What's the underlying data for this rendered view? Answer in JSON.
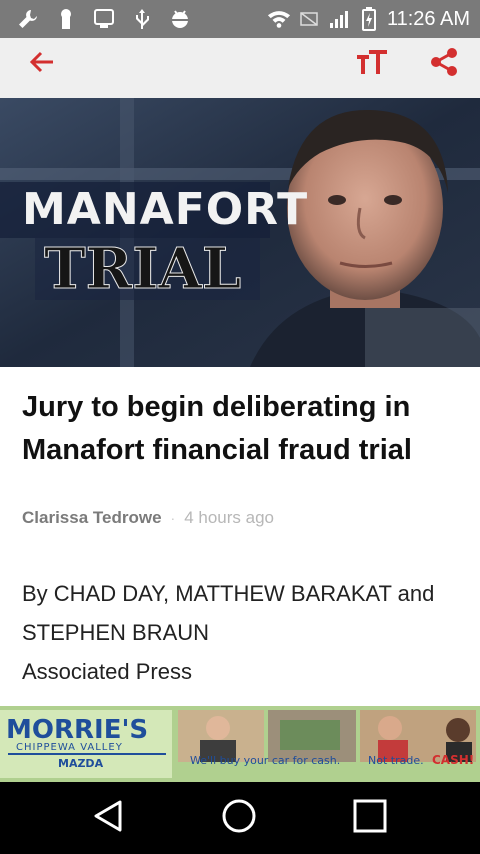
{
  "status_bar": {
    "time": "11:26 AM",
    "usb_badge": "100"
  },
  "toolbar": {
    "back_icon": "arrow-left-icon",
    "text_size_icon": "text-size-icon",
    "share_icon": "share-icon",
    "accent_color": "#d32f2f"
  },
  "hero": {
    "line1": "MANAFORT",
    "line2": "TRIAL"
  },
  "article": {
    "title": "Jury to begin deliberating in Manafort financial fraud trial",
    "author": "Clarissa Tedrowe",
    "separator": "·",
    "time": "4 hours ago",
    "byline_line1": "By CHAD DAY, MATTHEW BARAKAT and",
    "byline_line2": "STEPHEN BRAUN",
    "byline_line3": "Associated Press"
  },
  "ad": {
    "brand": "MORRIE'S",
    "sub": "CHIPPEWA VALLEY",
    "make": "MAZDA",
    "tagline": "We'll buy your car for cash.",
    "tagline2": "Not trade.",
    "cash": "CASH!"
  },
  "navbar": {
    "back_icon": "triangle-back-icon",
    "home_icon": "circle-home-icon",
    "recents_icon": "square-recents-icon"
  }
}
